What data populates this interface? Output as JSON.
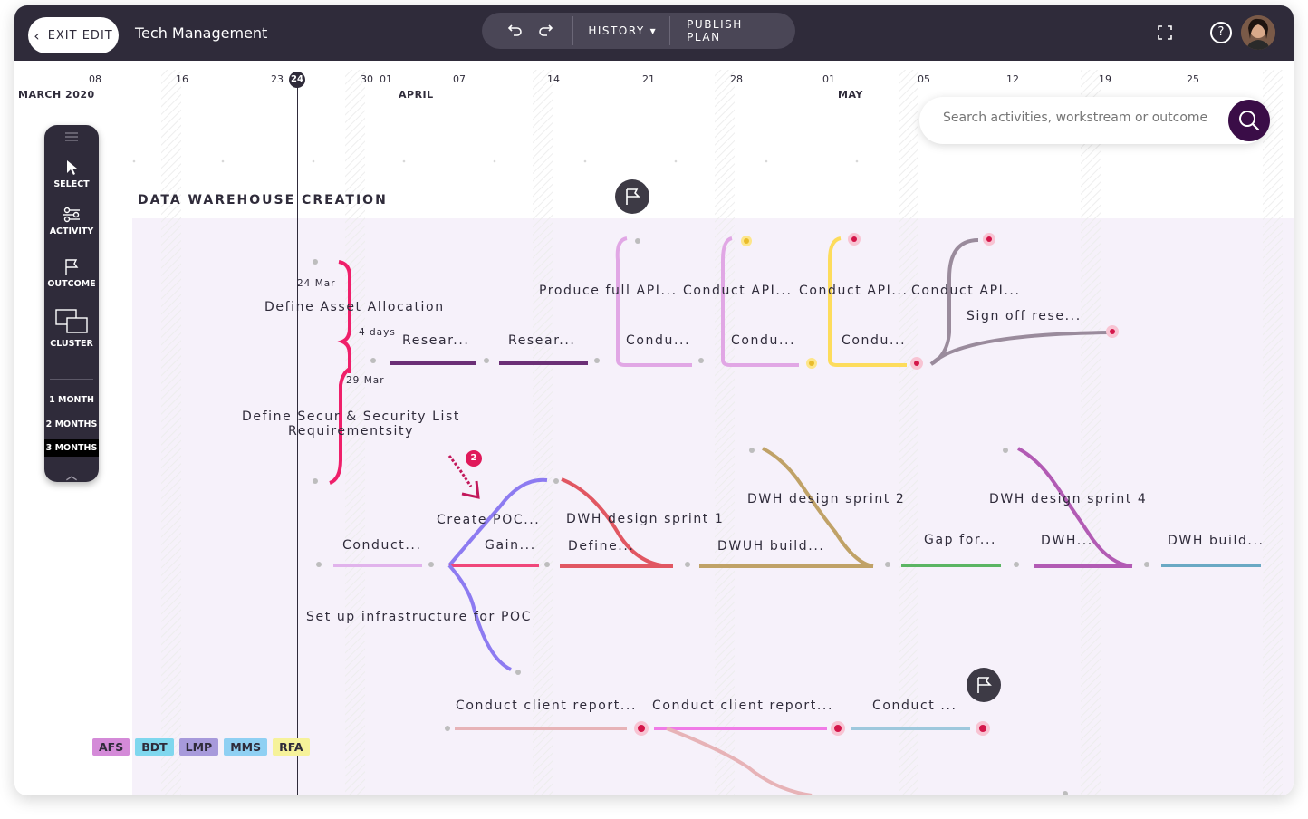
{
  "header": {
    "exit_label": "EXIT EDIT",
    "title": "Tech Management",
    "history_label": "HISTORY",
    "publish_label": "PUBLISH PLAN"
  },
  "timeline": {
    "month_march": "MARCH 2020",
    "month_april": "APRIL",
    "month_may": "MAY",
    "today": "24",
    "ticks": [
      "08",
      "16",
      "23",
      "30",
      "01",
      "07",
      "14",
      "21",
      "28",
      "01",
      "05",
      "12",
      "19",
      "25"
    ]
  },
  "search": {
    "placeholder": "Search activities, workstream or outcome"
  },
  "section": {
    "title": "DATA WAREHOUSE CREATION"
  },
  "sidebar": {
    "select": "SELECT",
    "activity": "ACTIVITY",
    "outcome": "OUTCOME",
    "cluster": "CLUSTER",
    "zoom_1": "1 MONTH",
    "zoom_2": "2 MONTHS",
    "zoom_3": "3 MONTHS",
    "active_zoom": "3 MONTHS"
  },
  "activities": {
    "date_start": "24 Mar",
    "define_asset": "Define Asset Allocation",
    "duration": "4 days",
    "date_end": "29 Mar",
    "define_secur_1": "Define Secur & Security List",
    "define_secur_2": "Requirementsity",
    "resear_1": "Resear...",
    "resear_2": "Resear...",
    "produce_api": "Produce full API...",
    "conduct_api_1": "Conduct API...",
    "conduct_api_2": "Conduct API...",
    "conduct_api_3": "Conduct API...",
    "condu_1": "Condu...",
    "condu_2": "Condu...",
    "condu_3": "Condu...",
    "sign_off": "Sign off rese...",
    "create_poc": "Create POC...",
    "conduct_1": "Conduct...",
    "gain": "Gain...",
    "dwh_sprint_1": "DWH design sprint 1",
    "define_dots": "Define...",
    "dwh_sprint_2": "DWH design sprint 2",
    "dwuh_build": "DWUH build...",
    "gap_for": "Gap for...",
    "dwh_sprint_4": "DWH design sprint 4",
    "dwh_dots": "DWH...",
    "dwh_build": "DWH build...",
    "setup_infra": "Set up infrastructure for POC",
    "client_report_1": "Conduct client report...",
    "client_report_2": "Conduct client report...",
    "conduct_short": "Conduct ...",
    "notification_count": "2"
  },
  "tags": [
    {
      "label": "AFS",
      "color": "#d48ad8"
    },
    {
      "label": "BDT",
      "color": "#7fd7ee"
    },
    {
      "label": "LMP",
      "color": "#a79adb"
    },
    {
      "label": "MMS",
      "color": "#8fd0f3"
    },
    {
      "label": "RFA",
      "color": "#f6f29a"
    }
  ],
  "colors": {
    "topbar": "#2f2b3a",
    "accent": "#3a0d47",
    "workstream_bg": "#f6f1fa"
  },
  "icons": [
    "chevron-left-icon",
    "undo-icon",
    "redo-icon",
    "caret-down-icon",
    "expand-icon",
    "help-icon",
    "search-icon",
    "cursor-icon",
    "activity-icon",
    "flag-icon",
    "cluster-icon",
    "collapse-icon"
  ]
}
